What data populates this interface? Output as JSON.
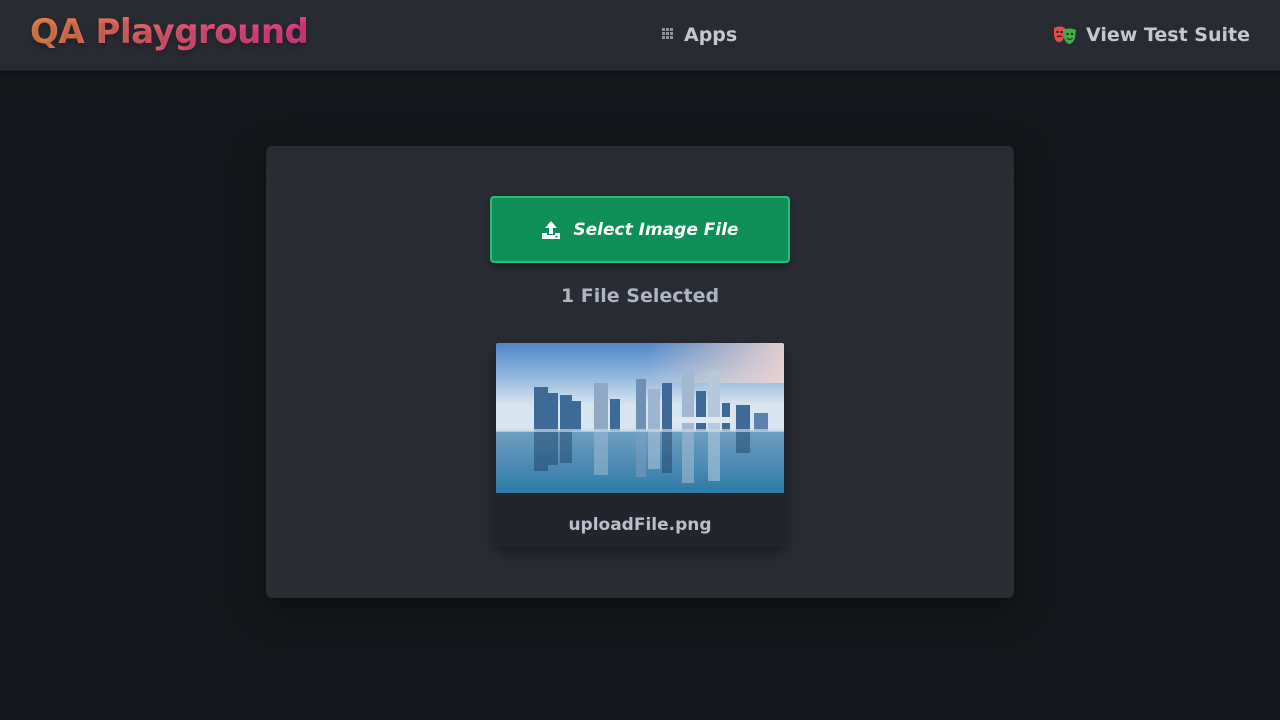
{
  "navbar": {
    "brand": "QA Playground",
    "apps_label": "Apps",
    "suite_label": "View Test Suite",
    "apps_icon": "grid-icon",
    "suite_icon": "theater-masks-icon"
  },
  "upload": {
    "button_label": "Select Image File",
    "button_icon": "upload-icon",
    "file_count_text": "1 File Selected",
    "files": [
      {
        "name": "uploadFile.png"
      }
    ]
  },
  "colors": {
    "background": "#14171b",
    "navbar": "#282b32",
    "card": "#292c33",
    "button": "#0f8f58",
    "brand_gradient_start": "#f08a4b",
    "brand_gradient_end": "#ec3f8f"
  }
}
